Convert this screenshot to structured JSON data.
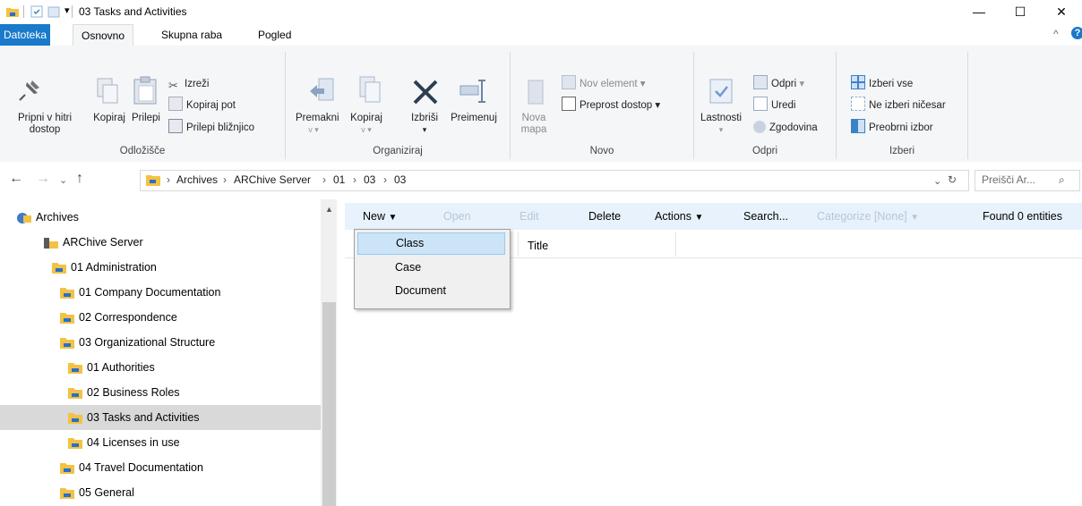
{
  "window": {
    "title": "03 Tasks and Activities",
    "controls": {
      "minimize": "—",
      "maximize": "☐",
      "close": "✕"
    }
  },
  "ribbon_tabs": [
    "Datoteka",
    "Osnovno",
    "Skupna raba",
    "Pogled"
  ],
  "ribbon": {
    "clipboard": {
      "pin": "Pripni v hitri dostop",
      "copy": "Kopiraj",
      "paste": "Prilepi",
      "cut": "Izreži",
      "copy_path": "Kopiraj pot",
      "paste_shortcut": "Prilepi bližnjico",
      "label": "Odložišče"
    },
    "organize": {
      "move": "Premakni",
      "copy_to": "Kopiraj",
      "delete": "Izbriši",
      "rename": "Preimenuj",
      "label": "Organiziraj"
    },
    "new": {
      "new_folder": "Nova mapa",
      "new_item": "Nov element",
      "easy_access": "Preprost dostop",
      "label": "Novo"
    },
    "open": {
      "properties": "Lastnosti",
      "open": "Odpri",
      "edit": "Uredi",
      "history": "Zgodovina",
      "label": "Odpri"
    },
    "select": {
      "select_all": "Izberi vse",
      "select_none": "Ne izberi ničesar",
      "invert": "Preobrni izbor",
      "label": "Izberi"
    }
  },
  "address": {
    "crumbs": [
      "Archives",
      "ARChive Server",
      "01",
      "03",
      "03"
    ],
    "search_placeholder": "Preišči Ar..."
  },
  "tree": [
    {
      "label": "Archives",
      "level": 0
    },
    {
      "label": "ARChive Server",
      "level": 1
    },
    {
      "label": "01 Administration",
      "level": 2
    },
    {
      "label": "01 Company Documentation",
      "level": 3
    },
    {
      "label": "02 Correspondence",
      "level": 3
    },
    {
      "label": "03 Organizational Structure",
      "level": 3
    },
    {
      "label": "01 Authorities",
      "level": 4
    },
    {
      "label": "02 Business Roles",
      "level": 4
    },
    {
      "label": "03 Tasks and Activities",
      "level": 4,
      "selected": true
    },
    {
      "label": "04 Licenses in use",
      "level": 4
    },
    {
      "label": "04 Travel Documentation",
      "level": 3
    },
    {
      "label": "05 General",
      "level": 3
    }
  ],
  "toolbar": {
    "new": "New",
    "open": "Open",
    "edit": "Edit",
    "delete": "Delete",
    "actions": "Actions",
    "search": "Search...",
    "categorize": "Categorize [None]",
    "found": "Found 0 entities"
  },
  "columns": {
    "title": "Title"
  },
  "new_menu": [
    "Class",
    "Case",
    "Document"
  ],
  "colors": {
    "file_tab": "#1979ca",
    "toolbar_bg": "#e8f2fc",
    "menu_highlight": "#cce4f7",
    "folder": "#f3c244"
  }
}
